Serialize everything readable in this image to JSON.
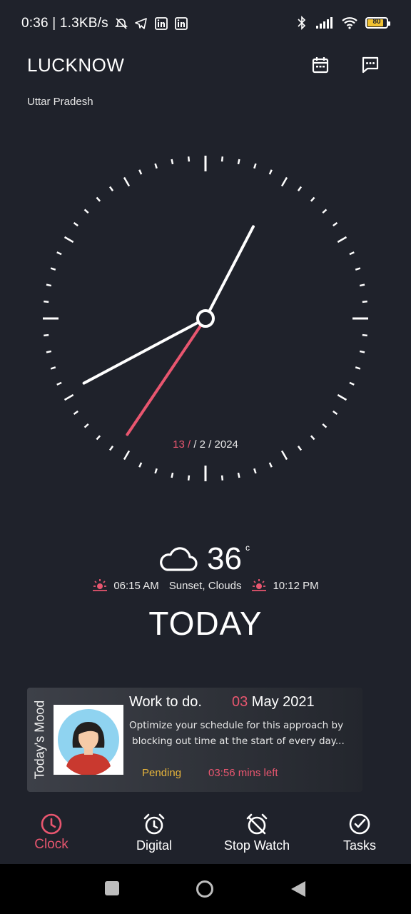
{
  "status_bar": {
    "time_speed": "0:36 | 1.3KB/s",
    "icons_left": [
      "alarm-off-icon",
      "telegram-icon",
      "linkedin-icon",
      "linkedin-icon"
    ],
    "icons_right": [
      "bluetooth-icon",
      "signal-icon",
      "wifi-icon",
      "battery-icon"
    ],
    "battery_level": "80"
  },
  "header": {
    "city": "LUCKNOW",
    "state": "Uttar Pradesh",
    "buttons": [
      "calendar-icon",
      "message-icon"
    ]
  },
  "clock": {
    "time_shown": {
      "hour": 8,
      "minute": 4,
      "second": 35
    },
    "date_day": "13",
    "date_rest": " / 2 / 2024",
    "date_sep": " /"
  },
  "weather": {
    "icon": "cloud-icon",
    "temperature": "36",
    "unit": "c",
    "sunrise": "06:15 AM",
    "condition": "Sunset, Clouds",
    "sunset": "10:12 PM",
    "day_label": "TODAY"
  },
  "mood_card": {
    "side_label": "Today's Mood",
    "title": "Work to do.",
    "date_day": "03",
    "date_month_year": " May 2021",
    "description_line1": "Optimize your schedule for this approach by",
    "description_line2": "blocking out time at the start of every day...",
    "status": "Pending",
    "time_left": "03:56 mins left"
  },
  "bottom_nav": {
    "items": [
      {
        "label": "Clock",
        "icon": "clock-icon",
        "active": true
      },
      {
        "label": "Digital",
        "icon": "alarm-clock-icon",
        "active": false
      },
      {
        "label": "Stop Watch",
        "icon": "alarm-off-icon",
        "active": false
      },
      {
        "label": "Tasks",
        "icon": "check-circle-icon",
        "active": false
      }
    ]
  },
  "colors": {
    "background": "#1f222b",
    "accent": "#e8566f",
    "pending": "#e6b43b"
  }
}
